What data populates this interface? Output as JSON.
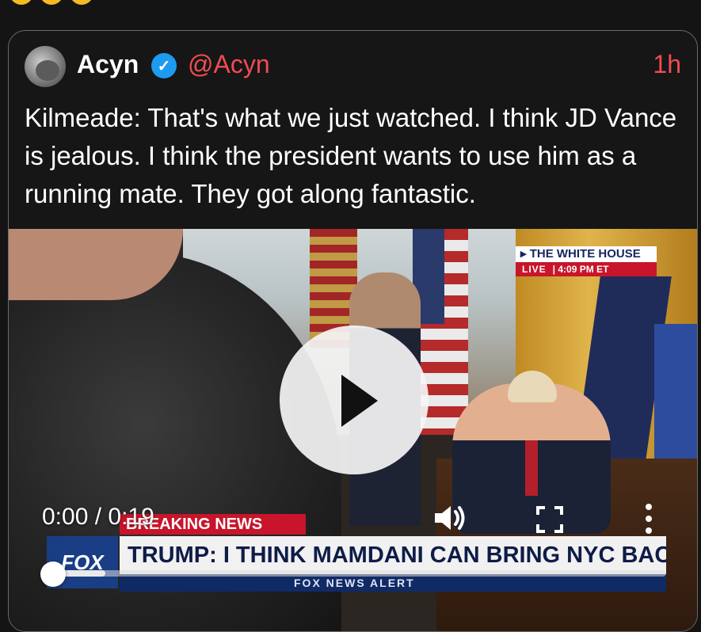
{
  "tweet": {
    "author_name": "Acyn",
    "handle": "@Acyn",
    "time": "1h",
    "verified": true,
    "text": "Kilmeade: That's what we just watched. I think JD Vance is jealous. I think the president wants to use him as a running mate. They got along fantastic."
  },
  "video": {
    "overlay": {
      "location": "THE WHITE HOUSE",
      "live": "LIVE",
      "live_time": "4:09 PM ET",
      "breaking": "BREAKING NEWS",
      "headline": "TRUMP: I THINK MAMDANI CAN BRING NYC BACK",
      "network_logo": "FOX",
      "sub_banner": "FOX NEWS ALERT"
    },
    "player": {
      "time_display": "0:00 / 0:19",
      "progress_fraction": 0.0,
      "buffered_fraction": 0.08
    }
  },
  "colors": {
    "accent": "#f04c52",
    "verified": "#1d9bf0",
    "background": "#141414"
  },
  "icons": [
    "verified-badge-icon",
    "play-icon",
    "volume-icon",
    "fullscreen-icon",
    "more-vert-icon"
  ]
}
